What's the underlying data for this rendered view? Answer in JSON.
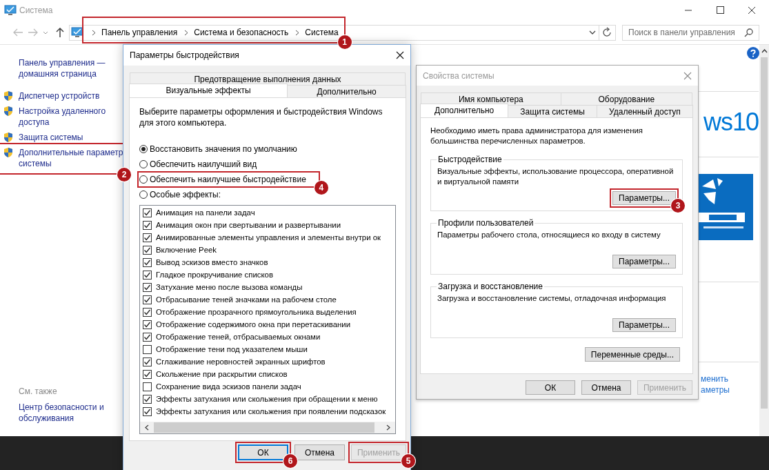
{
  "control_panel": {
    "title": "Система",
    "breadcrumbs": [
      "Панель управления",
      "Система и безопасность",
      "Система"
    ],
    "breadcrumbs_callout": "1",
    "search": {
      "placeholder": "Поиск в панели управления"
    },
    "sidebar": {
      "home_link": [
        "Панель управления —",
        "домашняя страница"
      ],
      "items": [
        {
          "lines": [
            "Диспетчер устройств"
          ]
        },
        {
          "lines": [
            "Настройка удаленного",
            "доступа"
          ]
        },
        {
          "lines": [
            "Защита системы"
          ]
        },
        {
          "lines": [
            "Дополнительные параметр",
            "системы"
          ],
          "callout": "2"
        }
      ],
      "see_also": {
        "heading": "См. также",
        "links": [
          [
            "Центр безопасности и",
            "обслуживания"
          ]
        ]
      }
    },
    "logo_text": "ws10",
    "link_fragment": [
      "менить",
      "аметры"
    ]
  },
  "performance_dialog": {
    "title": "Параметры быстродействия",
    "active": true,
    "tab_rows": [
      [
        {
          "label": "Предотвращение выполнения данных",
          "selected": false
        }
      ],
      [
        {
          "label": "Визуальные эффекты",
          "selected": true
        },
        {
          "label": "Дополнительно",
          "selected": false
        }
      ]
    ],
    "description": "Выберите параметры оформления и быстродействия Windows для этого компьютера.",
    "options": [
      {
        "label": "Восстановить значения по умолчанию",
        "selected": true
      },
      {
        "label": "Обеспечить наилучший вид",
        "selected": false
      },
      {
        "label": "Обеспечить наилучшее быстродействие",
        "selected": false,
        "callout": "4"
      },
      {
        "label": "Особые эффекты:",
        "selected": false
      }
    ],
    "effects": [
      {
        "label": "Анимация на панели задач",
        "checked": true
      },
      {
        "label": "Анимация окон при свертывании и развертывании",
        "checked": true
      },
      {
        "label": "Анимированные элементы управления и элементы внутри ок",
        "checked": true
      },
      {
        "label": "Включение Peek",
        "checked": true
      },
      {
        "label": "Вывод эскизов вместо значков",
        "checked": true
      },
      {
        "label": "Гладкое прокручивание списков",
        "checked": true
      },
      {
        "label": "Затухание меню после вызова команды",
        "checked": true
      },
      {
        "label": "Отбрасывание теней значками на рабочем столе",
        "checked": true
      },
      {
        "label": "Отображение прозрачного прямоугольника выделения",
        "checked": true
      },
      {
        "label": "Отображение содержимого окна при перетаскивании",
        "checked": true
      },
      {
        "label": "Отображение теней, отбрасываемых окнами",
        "checked": true
      },
      {
        "label": "Отображение тени под указателем мыши",
        "checked": false
      },
      {
        "label": "Сглаживание неровностей экранных шрифтов",
        "checked": true
      },
      {
        "label": "Скольжение при раскрытии списков",
        "checked": true
      },
      {
        "label": "Сохранение вида эскизов панели задач",
        "checked": false
      },
      {
        "label": "Эффекты затухания или скольжения при обращении к меню",
        "checked": true
      },
      {
        "label": "Эффекты затухания или скольжения при появлении подсказок",
        "checked": true
      }
    ],
    "buttons": [
      {
        "label": "ОК",
        "default": true,
        "disabled": false,
        "callout": "6"
      },
      {
        "label": "Отмена",
        "default": false,
        "disabled": false
      },
      {
        "label": "Применить",
        "default": false,
        "disabled": true,
        "callout": "5"
      }
    ]
  },
  "system_properties": {
    "title": "Свойства системы",
    "active": false,
    "tab_rows": [
      [
        {
          "label": "Имя компьютера",
          "selected": false
        },
        {
          "label": "Оборудование",
          "selected": false
        }
      ],
      [
        {
          "label": "Дополнительно",
          "selected": true
        },
        {
          "label": "Защита системы",
          "selected": false
        },
        {
          "label": "Удаленный доступ",
          "selected": false
        }
      ]
    ],
    "notice": "Необходимо иметь права администратора для изменения большинства перечисленных параметров.",
    "groups": [
      {
        "title": "Быстродействие",
        "text": "Визуальные эффекты, использование процессора, оперативной и виртуальной памяти",
        "button": {
          "label": "Параметры...",
          "callout": "3"
        }
      },
      {
        "title": "Профили пользователей",
        "text": "Параметры рабочего стола, относящиеся ко входу в систему",
        "button": {
          "label": "Параметры..."
        }
      },
      {
        "title": "Загрузка и восстановление",
        "text": "Загрузка и восстановление системы, отладочная информация",
        "button": {
          "label": "Параметры..."
        }
      }
    ],
    "environment_button": {
      "label": "Переменные среды..."
    },
    "buttons": [
      {
        "label": "ОК",
        "default": false,
        "disabled": false
      },
      {
        "label": "Отмена",
        "default": false,
        "disabled": false
      },
      {
        "label": "Применить",
        "default": false,
        "disabled": true
      }
    ]
  }
}
